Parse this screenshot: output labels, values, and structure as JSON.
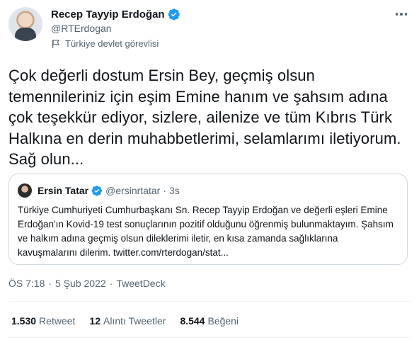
{
  "author": {
    "display_name": "Recep Tayyip Erdoğan",
    "handle": "@RTErdogan",
    "label": "Türkiye devlet görevlisi"
  },
  "tweet": {
    "text": "Çok değerli dostum Ersin Bey, geçmiş olsun temennileriniz için eşim Emine hanım ve şahsım adına çok teşekkür ediyor, sizlere, ailenize ve tüm Kıbrıs Türk Halkına en derin muhabbetlerimi, selamlarımı iletiyorum. Sağ olun..."
  },
  "quote": {
    "display_name": "Ersin Tatar",
    "handle": "@ersinrtatar",
    "separator": "·",
    "time": "3s",
    "text": "Türkiye Cumhuriyeti Cumhurbaşkanı Sn. Recep Tayyip Erdoğan ve değerli eşleri Emine Erdoğan'ın Kovid-19 test sonuçlarının pozitif olduğunu öğrenmiş bulunmaktayım. Şahsım ve halkım adına geçmiş olsun dileklerimi iletir, en kısa zamanda sağlıklarına kavuşmalarını dilerim. twitter.com/rterdogan/stat..."
  },
  "meta": {
    "time": "ÖS 7:18",
    "dot1": "·",
    "date": "5 Şub 2022",
    "dot2": "·",
    "source": "TweetDeck"
  },
  "stats": {
    "retweets_count": "1.530",
    "retweets_label": "Retweet",
    "quotes_count": "12",
    "quotes_label": "Alıntı Tweetler",
    "likes_count": "8.544",
    "likes_label": "Beğeni"
  },
  "colors": {
    "verified": "#1d9bf0",
    "secondary_text": "#536471",
    "border": "#cfd9de"
  },
  "icons": [
    "verified-badge-icon",
    "flag-icon",
    "more-icon"
  ]
}
